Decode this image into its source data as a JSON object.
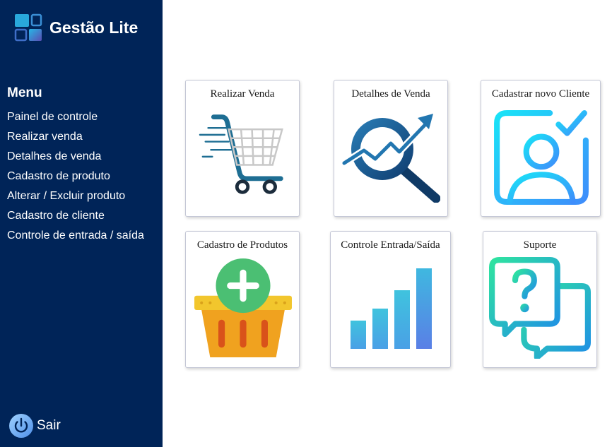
{
  "app": {
    "name": "Gestão Lite"
  },
  "sidebar": {
    "menu_title": "Menu",
    "items": [
      {
        "label": "Painel de controle"
      },
      {
        "label": "Realizar venda"
      },
      {
        "label": "Detalhes de venda"
      },
      {
        "label": "Cadastro de produto"
      },
      {
        "label": "Alterar / Excluir produto"
      },
      {
        "label": "Cadastro de cliente"
      },
      {
        "label": "Controle de entrada / saída"
      }
    ],
    "logout_label": "Sair"
  },
  "cards": [
    {
      "title": "Realizar Venda",
      "icon": "shopping-cart-icon"
    },
    {
      "title": "Detalhes de Venda",
      "icon": "magnifier-trend-icon"
    },
    {
      "title": "Cadastrar novo Cliente",
      "icon": "user-check-icon"
    },
    {
      "title": "Cadastro de Produtos",
      "icon": "basket-add-icon"
    },
    {
      "title": "Controle Entrada/Saída",
      "icon": "bar-chart-icon"
    },
    {
      "title": "Suporte",
      "icon": "help-chat-icon"
    }
  ],
  "colors": {
    "sidebar_bg": "#002458",
    "card_border": "#c4c7d6",
    "cart_blue": "#1e6e93",
    "client_cyan": "#23d0f5",
    "basket_orange": "#f0a21f",
    "plus_green": "#4bbf73",
    "bars_blue": "#4aa6e0",
    "support_green": "#2de0a6"
  }
}
